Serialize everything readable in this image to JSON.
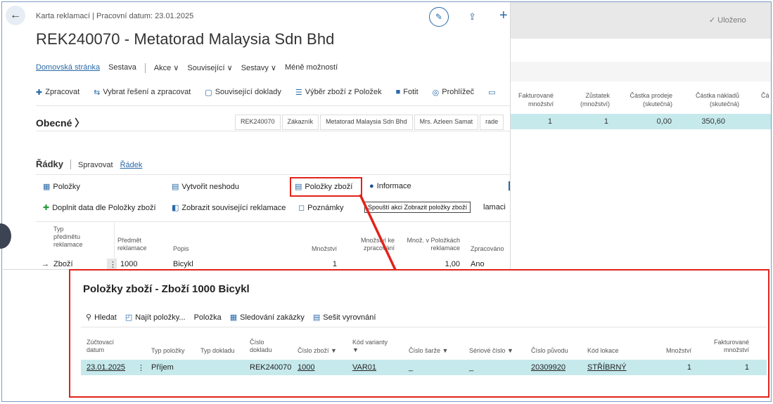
{
  "background_page": {
    "saved_status": "✓ Uloženo",
    "table_headers": [
      "Fakturované množství",
      "Zůstatek (množství)",
      "Částka prodeje (skutečná)",
      "Částka nákladů (skutečná)",
      "Čá"
    ],
    "row_values": [
      "1",
      "1",
      "0,00",
      "350,60"
    ]
  },
  "card": {
    "caption": "Karta reklamací | Pracovní datum: 23.01.2025",
    "title": "REK240070 - Metatorad Malaysia Sdn Bhd",
    "nav": {
      "home": "Domovská stránka",
      "report": "Sestava",
      "actions": "Akce ∨",
      "related": "Související ∨",
      "reports": "Sestavy ∨",
      "less": "Méně možností"
    },
    "actions": {
      "process": "Zpracovat",
      "choose_solution": "Vybrat řešení a zpracovat",
      "related_docs": "Související doklady",
      "select_items": "Výběr zboží z Položek",
      "photo": "Fotit",
      "browser": "Prohlížeč"
    },
    "general": {
      "heading": "Obecné 〉",
      "summary": [
        "REK240070",
        "Zákazník",
        "Metatorad Malaysia Sdn Bhd",
        "Mrs. Azleen Samat",
        "rade"
      ]
    },
    "lines": {
      "heading": "Řádky",
      "manage": "Spravovat",
      "line": "Řádek",
      "actions": {
        "items": "Položky",
        "create_nonconformity": "Vytvořit neshodu",
        "item_entries": "Položky zboží",
        "information": "Informace",
        "fill_data": "Doplnit data dle Položky zboží",
        "show_related": "Zobrazit související reklamace",
        "notes": "Poznámky",
        "complaints_tail": "lamaci"
      },
      "tooltip": "Spouští akci Zobrazit položky zboží",
      "headers": {
        "type": "Typ předmětu reklamace",
        "subject": "Předmět reklamace",
        "description": "Popis",
        "quantity": "Množství",
        "qty_to_process": "Množství ke zpracování",
        "qty_in_entries": "Množ. v Položkách reklamace",
        "processed": "Zpracováno"
      },
      "row": {
        "type": "Zboží",
        "subject": "1000",
        "description": "Bicykl",
        "quantity": "1",
        "qty_in_entries": "1,00",
        "processed": "Ano"
      }
    }
  },
  "panel": {
    "title": "Položky zboží - Zboží 1000 Bicykl",
    "toolbar": {
      "search": "Hledat",
      "find": "Najít položky...",
      "item": "Položka",
      "tracking": "Sledování zakázky",
      "apply": "Sešit vyrovnání"
    },
    "headers": {
      "posting_date": "Zúčtovací datum",
      "entry_type": "Typ položky",
      "doc_type": "Typ dokladu",
      "doc_no": "Číslo dokladu",
      "item_no": "Číslo zboží",
      "variant": "Kód varianty",
      "lot_no": "Číslo šarže",
      "serial_no": "Sériové číslo",
      "origin_no": "Číslo původu",
      "location": "Kód lokace",
      "quantity": "Množství",
      "invoiced": "Fakturované množství"
    },
    "row": {
      "posting_date": "23.01.2025",
      "menu": "⋮",
      "entry_type": "Příjem",
      "doc_no": "REK240070",
      "item_no": "1000",
      "variant": "VAR01",
      "lot_no": "_",
      "serial_no": "_",
      "origin_no": "20309920",
      "location": "STŘÍBRNÝ",
      "quantity": "1",
      "invoiced": "1"
    }
  },
  "colors": {
    "accent": "#2a6aa8",
    "highlight_red": "#e2231a",
    "selected_row": "#c6e9ec"
  }
}
